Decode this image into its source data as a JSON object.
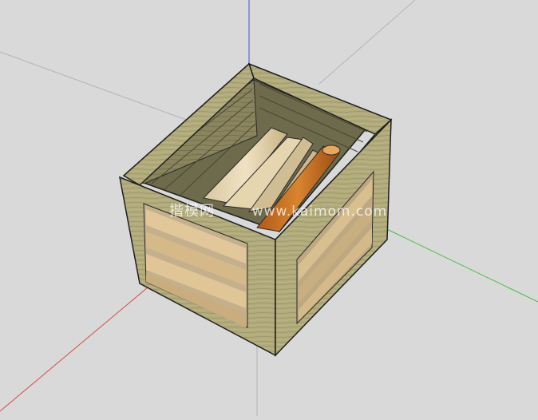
{
  "scene": {
    "background": "#d9d9d9",
    "axis_colors": {
      "red": "#d44a4a",
      "green": "#3fbf3f",
      "blue": "#4a4ad4"
    },
    "object": "wooden crate with firewood logs"
  },
  "watermark": {
    "chinese": "揩模网",
    "url": "www.kaimom.com"
  }
}
